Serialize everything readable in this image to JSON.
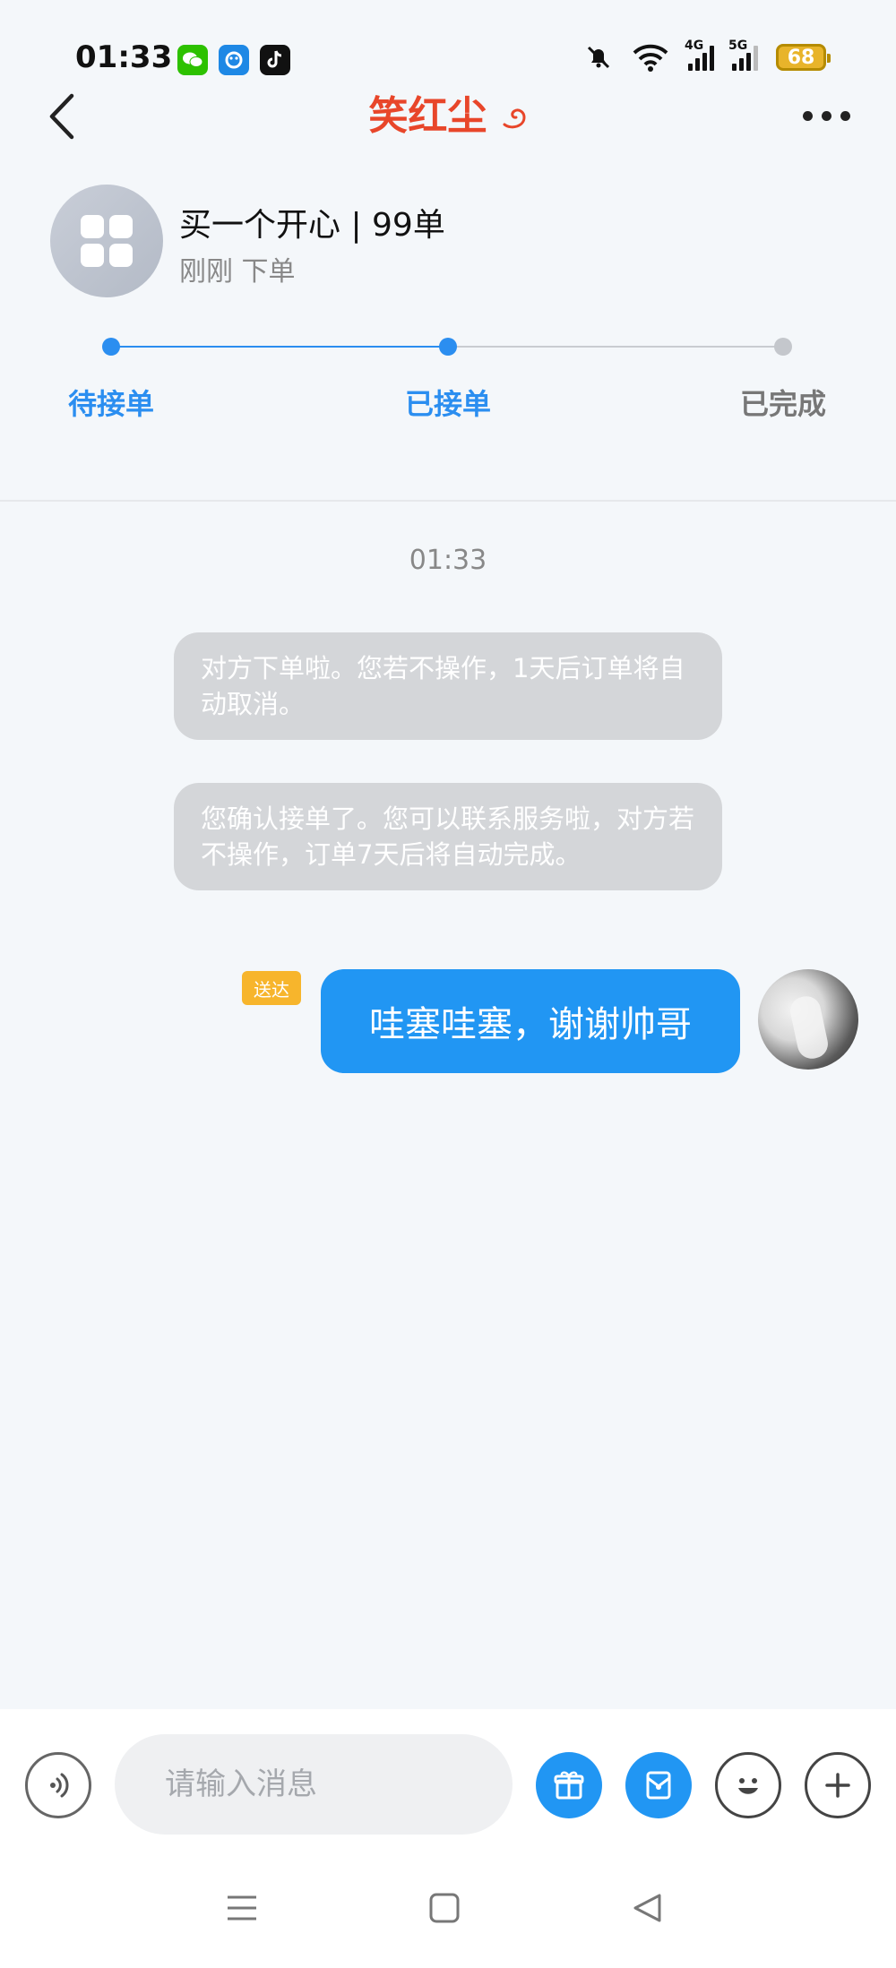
{
  "status_bar": {
    "time": "01:33",
    "app_icons": [
      "wechat-icon",
      "app-icon",
      "tiktok-icon"
    ],
    "network_1": "4G",
    "network_2": "5G",
    "battery": "68"
  },
  "header": {
    "title": "笑红尘",
    "back_icon": "chevron-left-icon",
    "more_icon": "more-dots-icon"
  },
  "order": {
    "title": "买一个开心 | 99单",
    "subtitle": "刚刚 下单"
  },
  "progress": {
    "steps": [
      {
        "label": "待接单",
        "state": "done"
      },
      {
        "label": "已接单",
        "state": "current"
      },
      {
        "label": "已完成",
        "state": "pending"
      }
    ]
  },
  "chat": {
    "time": "01:33",
    "system_messages": [
      "对方下单啦。您若不操作，1天后订单将自动取消。",
      "您确认接单了。您可以联系服务啦，对方若不操作，订单7天后将自动完成。"
    ],
    "my_message": {
      "text": "哇塞哇塞，谢谢帅哥",
      "status": "送达"
    }
  },
  "input_bar": {
    "placeholder": "请输入消息",
    "buttons": [
      "voice-icon",
      "gift-icon",
      "red-packet-icon",
      "emoji-icon",
      "plus-icon"
    ]
  },
  "colors": {
    "accent": "#2196f3",
    "title_red": "#e8462a",
    "badge_yellow": "#f7b52c"
  }
}
